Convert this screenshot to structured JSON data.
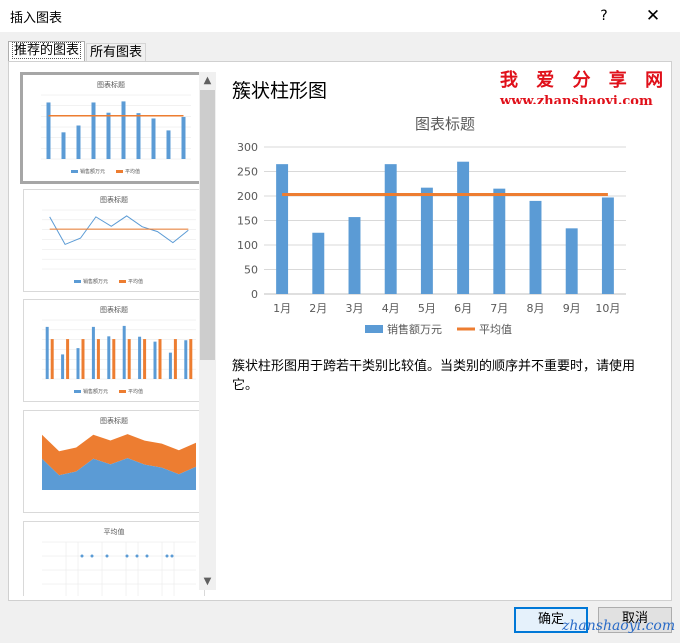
{
  "dialog": {
    "title": "插入图表",
    "help_label": "?",
    "close_label": "✕"
  },
  "tabs": [
    {
      "label": "推荐的图表"
    },
    {
      "label": "所有图表"
    }
  ],
  "thumbnails": [
    {
      "title": "图表标题",
      "kind": "bar+line",
      "legend": [
        "销售额万元",
        "平均值"
      ]
    },
    {
      "title": "图表标题",
      "kind": "line",
      "legend": [
        "销售额万元",
        "平均值"
      ]
    },
    {
      "title": "图表标题",
      "kind": "clustered-bar",
      "legend": [
        "销售额万元",
        "平均值"
      ]
    },
    {
      "title": "图表标题",
      "kind": "area",
      "legend": []
    },
    {
      "title": "平均值",
      "kind": "scatter",
      "legend": []
    }
  ],
  "scrollbar": {
    "up_label": "▲",
    "down_label": "▼"
  },
  "main": {
    "chart_type_name": "簇状柱形图",
    "description": "簇状柱形图用于跨若干类别比较值。当类别的顺序并不重要时，请使用它。"
  },
  "chart_data": {
    "type": "bar",
    "title": "图表标题",
    "categories": [
      "1月",
      "2月",
      "3月",
      "4月",
      "5月",
      "6月",
      "7月",
      "8月",
      "9月",
      "10月"
    ],
    "series": [
      {
        "name": "销售额万元",
        "type": "bar",
        "color": "#5b9bd5",
        "values": [
          265,
          125,
          157,
          265,
          217,
          270,
          215,
          190,
          134,
          197
        ]
      },
      {
        "name": "平均值",
        "type": "line",
        "color": "#ed7d31",
        "values": [
          203,
          203,
          203,
          203,
          203,
          203,
          203,
          203,
          203,
          203
        ]
      }
    ],
    "ylim": [
      0,
      300
    ],
    "yticks": [
      0,
      50,
      100,
      150,
      200,
      250,
      300
    ],
    "grid": true,
    "legend": "bottom"
  },
  "watermark": {
    "line1": "我 爱 分 享 网",
    "line2": "www.zhanshaoyi.com",
    "line3": "zhanshaoyi.com"
  },
  "buttons": {
    "ok_label": "确定",
    "cancel_label": "取消"
  },
  "colors": {
    "bar": "#5b9bd5",
    "avg_line": "#ed7d31",
    "area_orange": "#ed7d31",
    "accent": "#0078d7"
  }
}
